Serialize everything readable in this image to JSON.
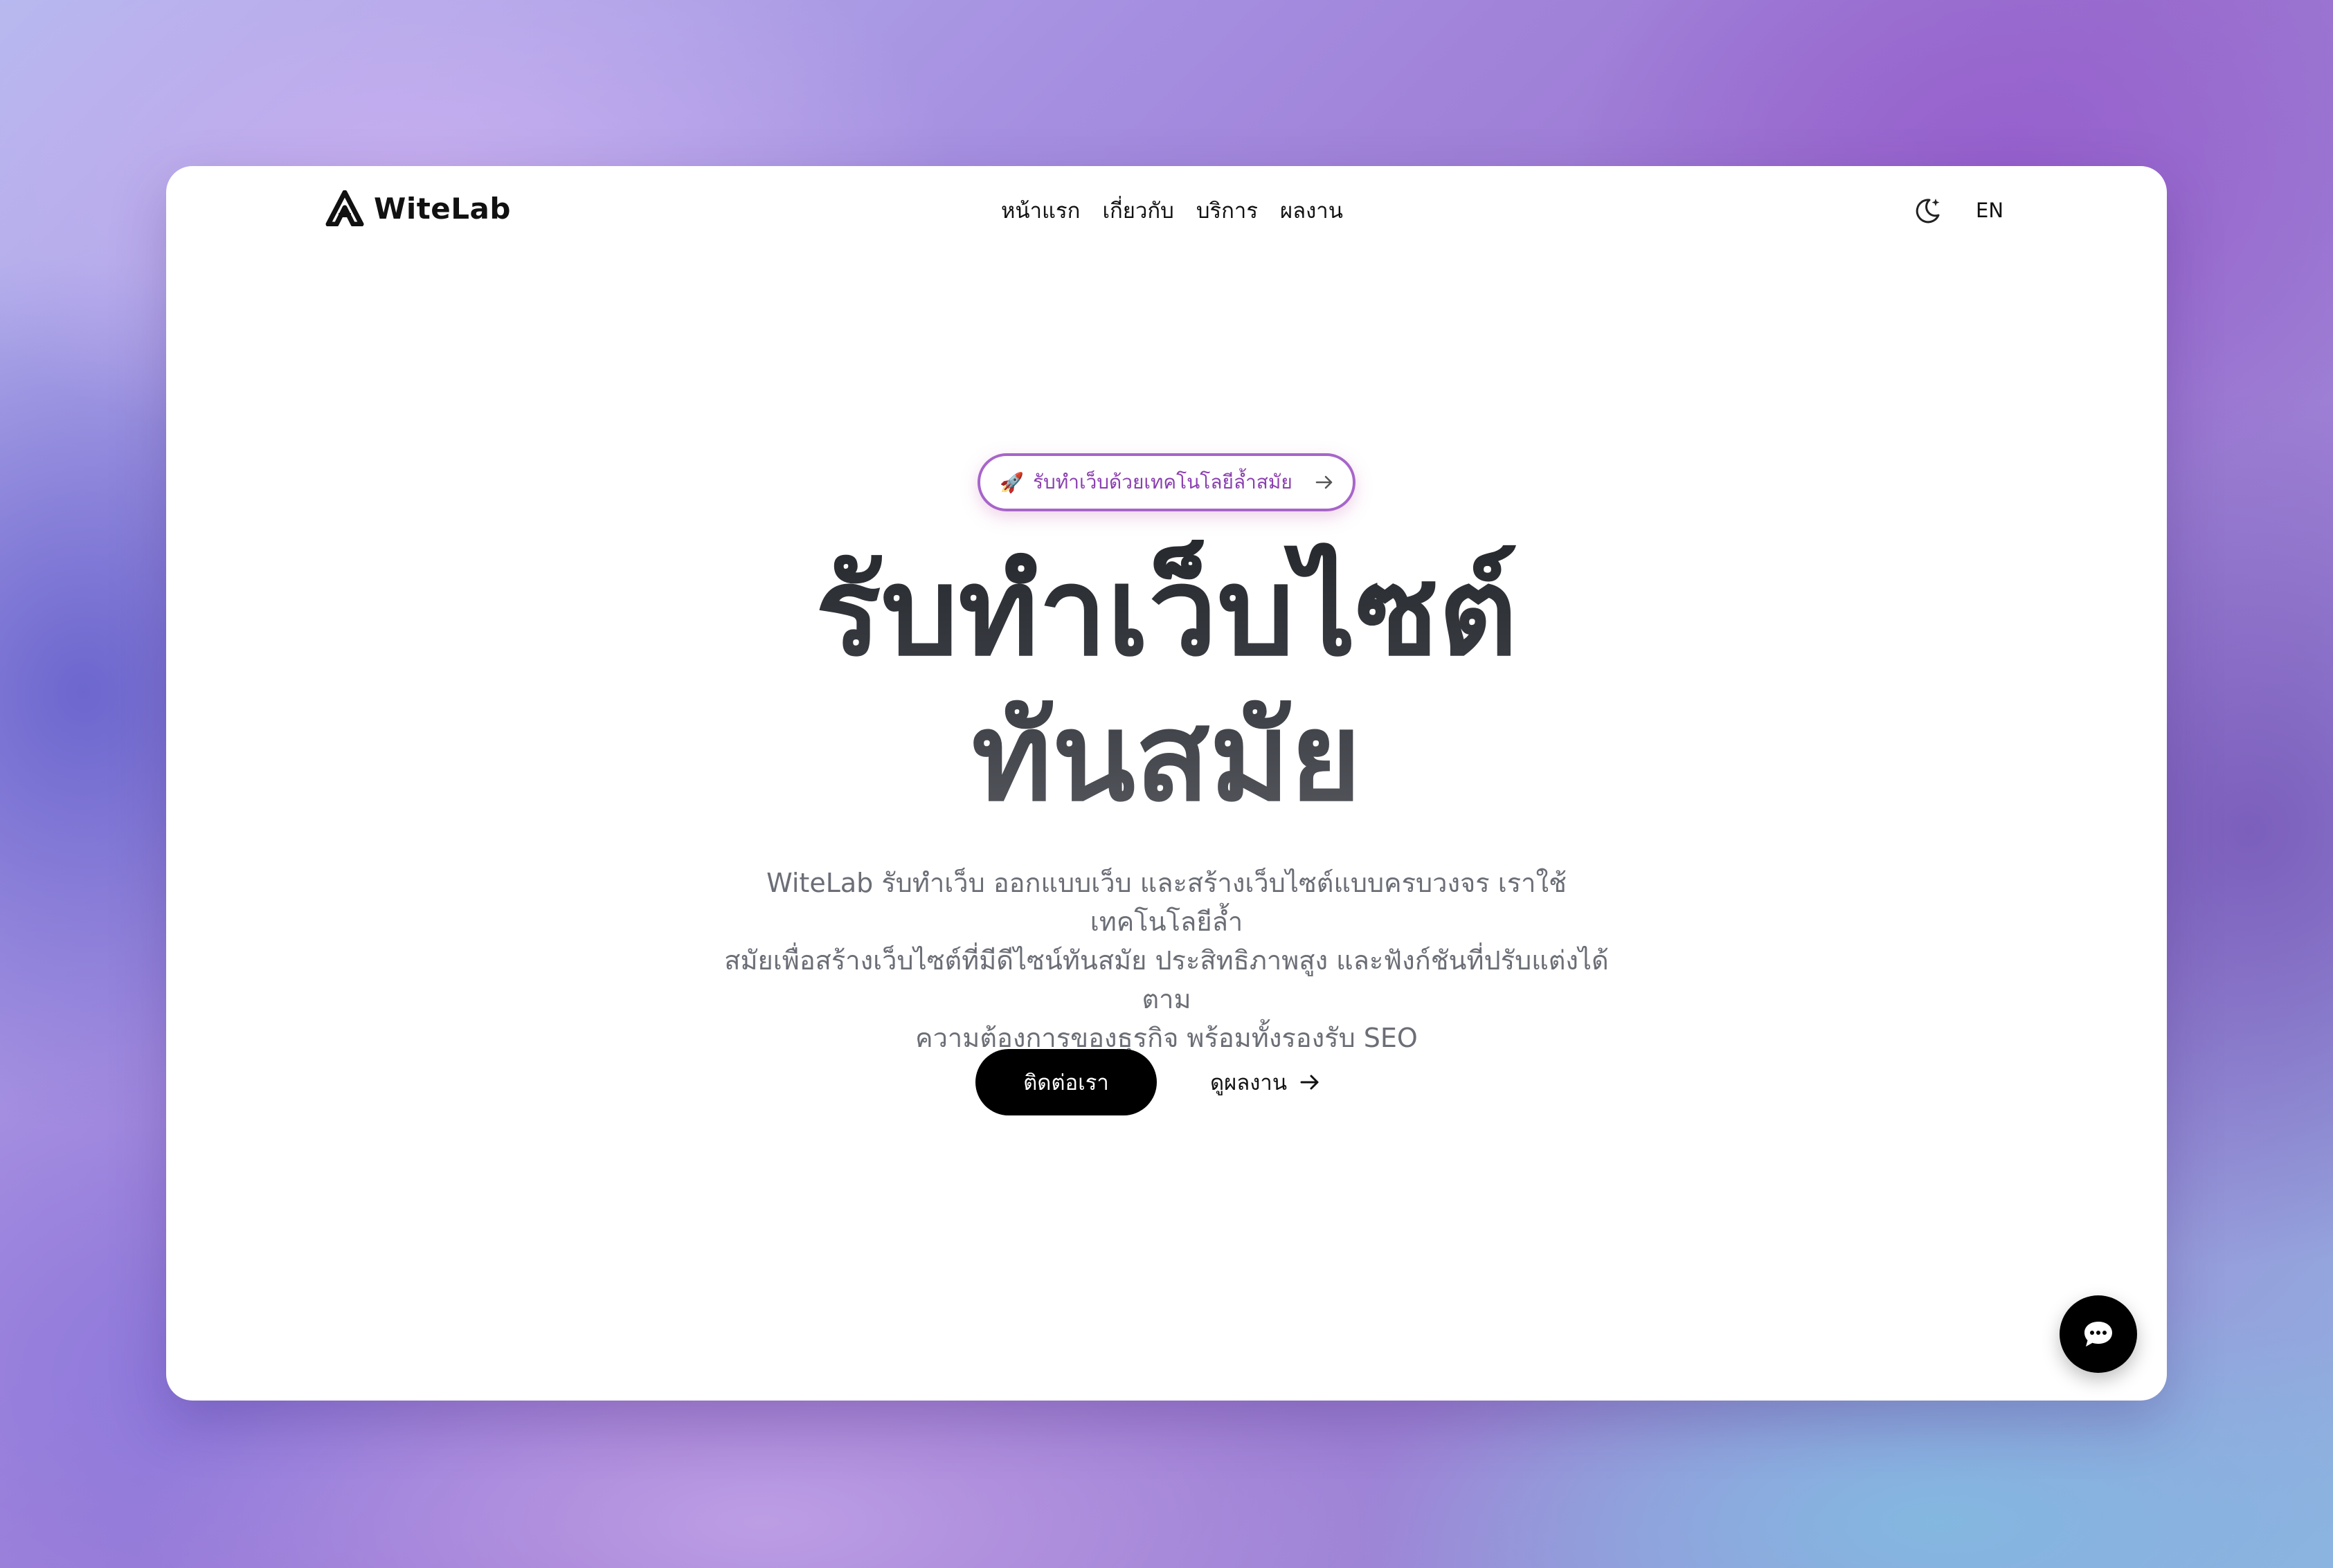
{
  "header": {
    "brand": "WiteLab",
    "nav": [
      {
        "label": "หน้าแรก"
      },
      {
        "label": "เกี่ยวกับ"
      },
      {
        "label": "บริการ"
      },
      {
        "label": "ผลงาน"
      }
    ],
    "theme_icon": "moon-stars-icon",
    "language": "EN"
  },
  "hero": {
    "badge": {
      "emoji": "🚀",
      "text": "รับทำเว็บด้วยเทคโนโลยีล้ำสมัย",
      "icon": "arrow-right-icon"
    },
    "title_line1": "รับทำเว็บไซต์",
    "title_line2": "ทันสมัย",
    "description_line1": "WiteLab รับทำเว็บ ออกแบบเว็บ และสร้างเว็บไซต์แบบครบวงจร เราใช้เทคโนโลยีล้ำ",
    "description_line2": "สมัยเพื่อสร้างเว็บไซต์ที่มีดีไซน์ทันสมัย ประสิทธิภาพสูง และฟังก์ชันที่ปรับแต่งได้ตาม",
    "description_line3": "ความต้องการของธุรกิจ พร้อมทั้งรองรับ SEO",
    "primary_cta": "ติดต่อเรา",
    "secondary_cta": "ดูผลงาน"
  },
  "chat": {
    "icon": "chat-bubble-icon"
  },
  "colors": {
    "accent_border": "#a765c9",
    "badge_text": "#8b3fb0",
    "button_bg": "#000000"
  }
}
